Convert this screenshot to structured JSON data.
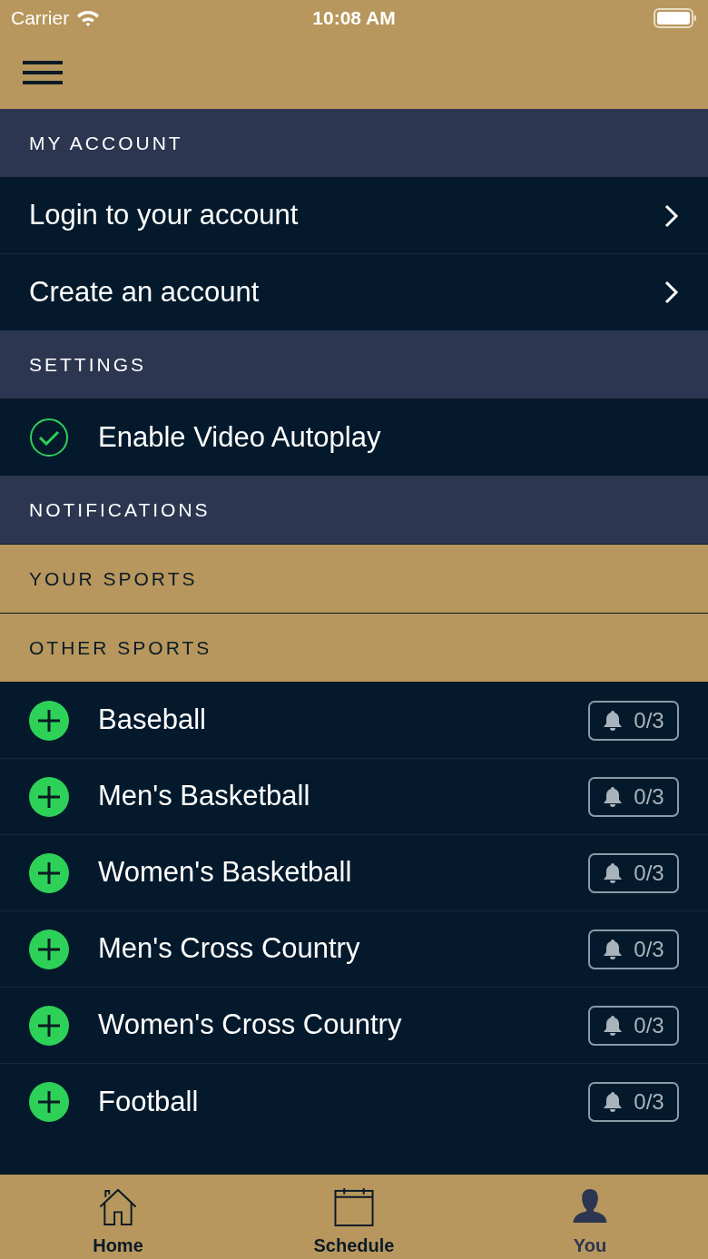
{
  "status_bar": {
    "carrier": "Carrier",
    "time": "10:08 AM"
  },
  "sections": [
    {
      "title": "MY ACCOUNT",
      "kind": "dark",
      "items": [
        {
          "kind": "link",
          "label": "Login to your account"
        },
        {
          "kind": "link",
          "label": "Create an account"
        }
      ]
    },
    {
      "title": "SETTINGS",
      "kind": "dark",
      "items": [
        {
          "kind": "toggle",
          "label": "Enable Video Autoplay",
          "checked": true
        }
      ]
    },
    {
      "title": "NOTIFICATIONS",
      "kind": "dark"
    },
    {
      "title": "YOUR SPORTS",
      "kind": "gold"
    },
    {
      "title": "OTHER SPORTS",
      "kind": "gold",
      "items": [
        {
          "kind": "sport",
          "label": "Baseball",
          "count": "0/3"
        },
        {
          "kind": "sport",
          "label": "Men's Basketball",
          "count": "0/3"
        },
        {
          "kind": "sport",
          "label": "Women's Basketball",
          "count": "0/3"
        },
        {
          "kind": "sport",
          "label": "Men's Cross Country",
          "count": "0/3"
        },
        {
          "kind": "sport",
          "label": "Women's Cross Country",
          "count": "0/3"
        },
        {
          "kind": "sport",
          "label": "Football",
          "count": "0/3"
        }
      ]
    }
  ],
  "tabs": [
    {
      "label": "Home",
      "kind": "home",
      "selected": false
    },
    {
      "label": "Schedule",
      "kind": "calendar",
      "selected": false
    },
    {
      "label": "You",
      "kind": "person",
      "selected": true
    }
  ]
}
